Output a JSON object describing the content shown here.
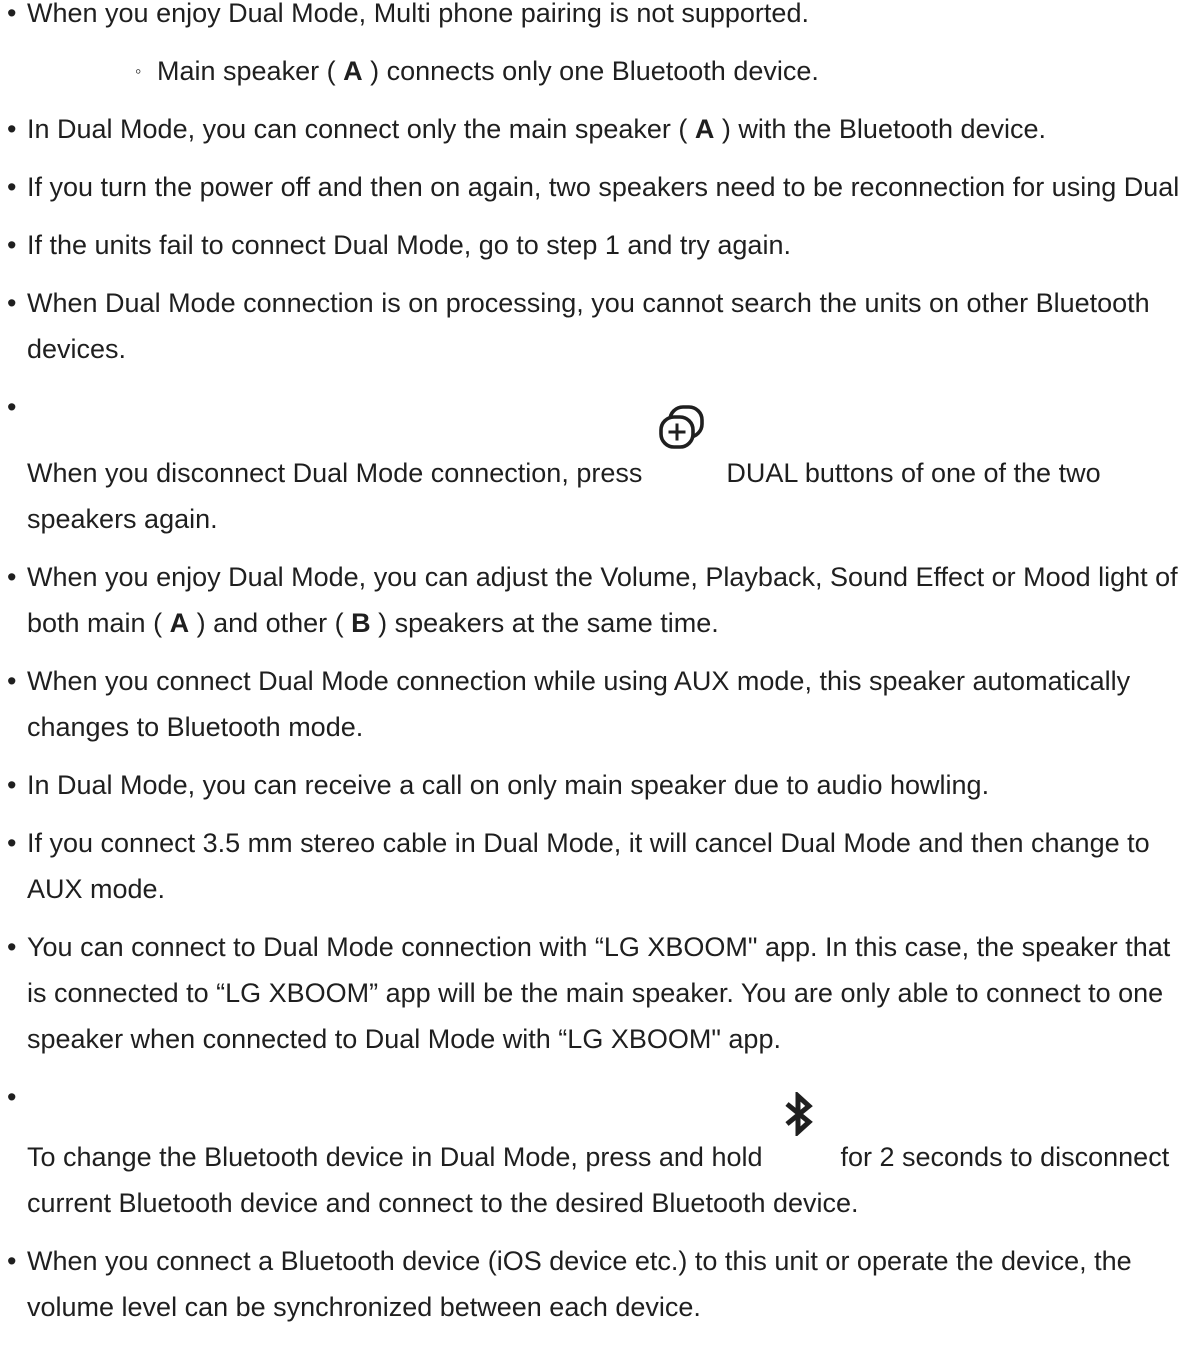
{
  "bullet_char": "•",
  "sub_bullet_char": "◦",
  "items": [
    {
      "text": "When you enjoy Dual Mode, Multi phone pairing is not supported."
    },
    {
      "sub": true,
      "pre": "Main speaker ( ",
      "b1": "A",
      "post": " ) connects only one Bluetooth device."
    },
    {
      "pre": "In Dual Mode, you can connect only the main speaker ( ",
      "b1": "A",
      "post": " ) with the Bluetooth device."
    },
    {
      "text": "If you turn the power off and then on again, two speakers need to be reconnection for using Dual"
    },
    {
      "text": "If the units fail to connect Dual Mode, go to step 1 and try again."
    },
    {
      "text": "When Dual Mode connection is on processing, you cannot search the units on other Bluetooth devices."
    },
    {
      "pre": "When you disconnect Dual Mode connection, press",
      "icon": "dual-button-icon",
      "post": "DUAL buttons of one of the two speakers again."
    },
    {
      "pre": "When you enjoy Dual Mode, you can adjust the Volume, Playback, Sound Effect or Mood light of both main ( ",
      "b1": "A",
      "mid": " ) and other ( ",
      "b2": "B",
      "post": " ) speakers at the same time."
    },
    {
      "text": "When you connect Dual Mode connection while using AUX mode, this speaker automatically changes to Bluetooth mode."
    },
    {
      "text": "In Dual Mode, you can receive a call on only main speaker due to audio howling."
    },
    {
      "text": "If you connect 3.5 mm stereo cable in Dual Mode, it will cancel Dual Mode and then change to AUX mode."
    },
    {
      "text": "You can connect to Dual Mode connection with “LG XBOOM\" app. In this case, the speaker that is connected to “LG XBOOM” app will be the main speaker. You are only able to connect to one speaker when connected to Dual Mode with “LG XBOOM\" app."
    },
    {
      "pre": "To change the Bluetooth device in Dual Mode, press and hold",
      "icon": "bluetooth-icon",
      "post": "for 2 seconds to disconnect current Bluetooth device and connect to the desired Bluetooth device."
    },
    {
      "text": "When you connect a Bluetooth device (iOS device etc.) to this unit or operate the device, the volume level can be synchronized between each device."
    }
  ]
}
